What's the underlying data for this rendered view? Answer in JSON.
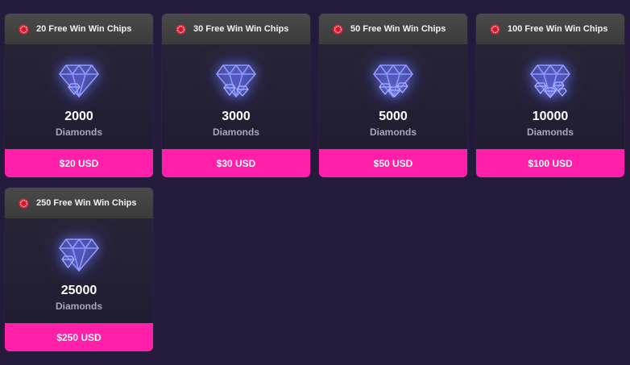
{
  "packages": [
    {
      "chips_label": "20 Free Win Win Chips",
      "amount": "2000",
      "unit": "Diamonds",
      "price": "$20 USD"
    },
    {
      "chips_label": "30 Free Win Win Chips",
      "amount": "3000",
      "unit": "Diamonds",
      "price": "$30 USD"
    },
    {
      "chips_label": "50 Free Win Win Chips",
      "amount": "5000",
      "unit": "Diamonds",
      "price": "$50 USD"
    },
    {
      "chips_label": "100 Free Win Win Chips",
      "amount": "10000",
      "unit": "Diamonds",
      "price": "$100 USD"
    },
    {
      "chips_label": "250 Free Win Win Chips",
      "amount": "25000",
      "unit": "Diamonds",
      "price": "$250 USD"
    }
  ],
  "icons": {
    "chip": "poker-chip-icon",
    "diamond": "diamond-icon"
  },
  "colors": {
    "background": "#231a3c",
    "card_header": "#434343",
    "price_bar": "#ff1fa8",
    "diamond_glow": "#7b82ff",
    "chip_red": "#e0263a"
  }
}
